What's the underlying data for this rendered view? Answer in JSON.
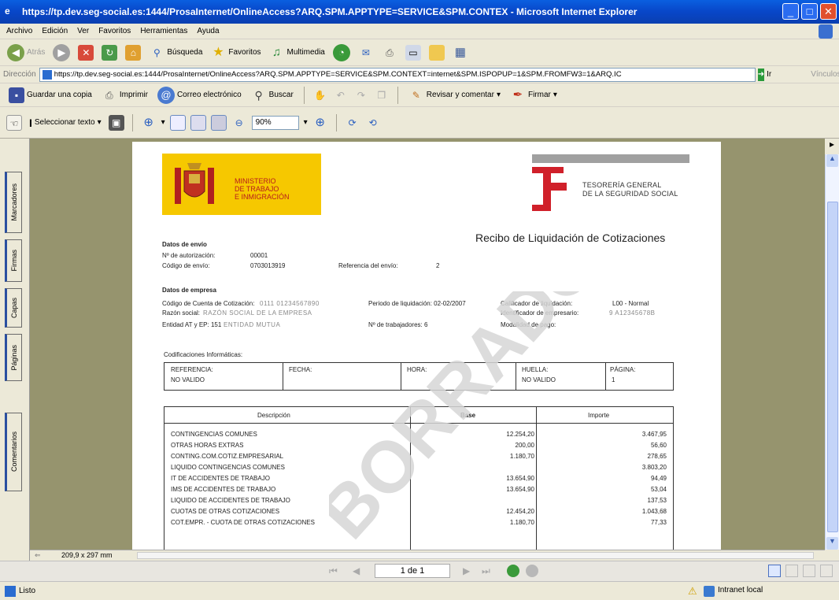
{
  "window": {
    "title": "https://tp.dev.seg-social.es:1444/ProsaInternet/OnlineAccess?ARQ.SPM.APPTYPE=SERVICE&SPM.CONTEX - Microsoft Internet Explorer",
    "minimize": "_",
    "maximize": "□",
    "close": "✕"
  },
  "menu": [
    "Archivo",
    "Edición",
    "Ver",
    "Favoritos",
    "Herramientas",
    "Ayuda"
  ],
  "toolbar": {
    "back": "Atrás",
    "search": "Búsqueda",
    "favorites": "Favoritos",
    "multimedia": "Multimedia"
  },
  "address": {
    "label": "Dirección",
    "url": "https://tp.dev.seg-social.es:1444/ProsaInternet/OnlineAccess?ARQ.SPM.APPTYPE=SERVICE&SPM.CONTEXT=internet&SPM.ISPOPUP=1&SPM.FROMFW3=1&ARQ.IC",
    "go": "Ir",
    "links": "Vínculos"
  },
  "pdf_toolbar": {
    "save_copy": "Guardar una copia",
    "print": "Imprimir",
    "email": "Correo electrónico",
    "search": "Buscar",
    "review": "Revisar y comentar",
    "sign": "Firmar",
    "select_text": "Seleccionar texto",
    "zoom": "90%"
  },
  "side_tabs": [
    "Marcadores",
    "Firmas",
    "Capas",
    "Páginas",
    "Comentarios"
  ],
  "page_size": "209,9 x 297 mm",
  "nav": {
    "page": "1 de 1"
  },
  "status": {
    "left": "Listo",
    "zone": "Intranet local"
  },
  "doc": {
    "ministry": "MINISTERIO\nDE TRABAJO\nE INMIGRACIÓN",
    "tgss": "TESORERÍA GENERAL\nDE LA SEGURIDAD SOCIAL",
    "title": "Recibo de Liquidación de Cotizaciones",
    "envio": {
      "heading": "Datos de envío",
      "auth_label": "Nº de autorización:",
      "auth_value": "00001",
      "code_label": "Código de envío:",
      "code_value": "0703013919",
      "ref_label": "Referencia del envío:",
      "ref_value": "2"
    },
    "empresa": {
      "heading": "Datos de empresa",
      "ccc_label": "Código de Cuenta de Cotización:",
      "ccc_value": "0111 01234567890",
      "period_label": "Periodo de liquidación: 02-02/2007",
      "calif_label": "Calificador de liquidación:",
      "calif_value": "L00 - Normal",
      "razon_label": "Razón social:",
      "razon_value": "RAZÓN SOCIAL DE LA EMPRESA",
      "ident_label": "Identificador de empresario:",
      "ident_value": "9 A12345678B",
      "entidad_label": "Entidad AT y EP: 151",
      "entidad_value": "ENTIDAD MUTUA",
      "trab_label": "Nº de trabajadores: 6",
      "modal_label": "Modalidad de pago:"
    },
    "codif": {
      "heading": "Codificaciones Informáticas:",
      "ref_label": "REFERENCIA:",
      "ref_value": "NO VALIDO",
      "fecha_label": "FECHA:",
      "hora_label": "HORA:",
      "huella_label": "HUELLA:",
      "huella_value": "NO VALIDO",
      "pagina_label": "PÁGINA:",
      "pagina_value": "1"
    },
    "items": {
      "headers": [
        "Descripción",
        "Base",
        "Importe"
      ],
      "rows": [
        [
          "CONTINGENCIAS COMUNES",
          "12.254,20",
          "3.467,95"
        ],
        [
          "OTRAS HORAS EXTRAS",
          "200,00",
          "56,60"
        ],
        [
          "CONTING.COM.COTIZ.EMPRESARIAL",
          "1.180,70",
          "278,65"
        ],
        [
          "LIQUIDO CONTINGENCIAS COMUNES",
          "",
          "3.803,20"
        ],
        [
          "IT DE ACCIDENTES DE TRABAJO",
          "13.654,90",
          "94,49"
        ],
        [
          "IMS DE ACCIDENTES DE TRABAJO",
          "13.654,90",
          "53,04"
        ],
        [
          "LIQUIDO DE ACCIDENTES DE TRABAJO",
          "",
          "137,53"
        ],
        [
          "CUOTAS DE OTRAS COTIZACIONES",
          "12.454,20",
          "1.043,68"
        ],
        [
          "COT.EMPR. - CUOTA DE OTRAS COTIZACIONES",
          "1.180,70",
          "77,33"
        ]
      ]
    },
    "watermark": "BORRADOR"
  }
}
